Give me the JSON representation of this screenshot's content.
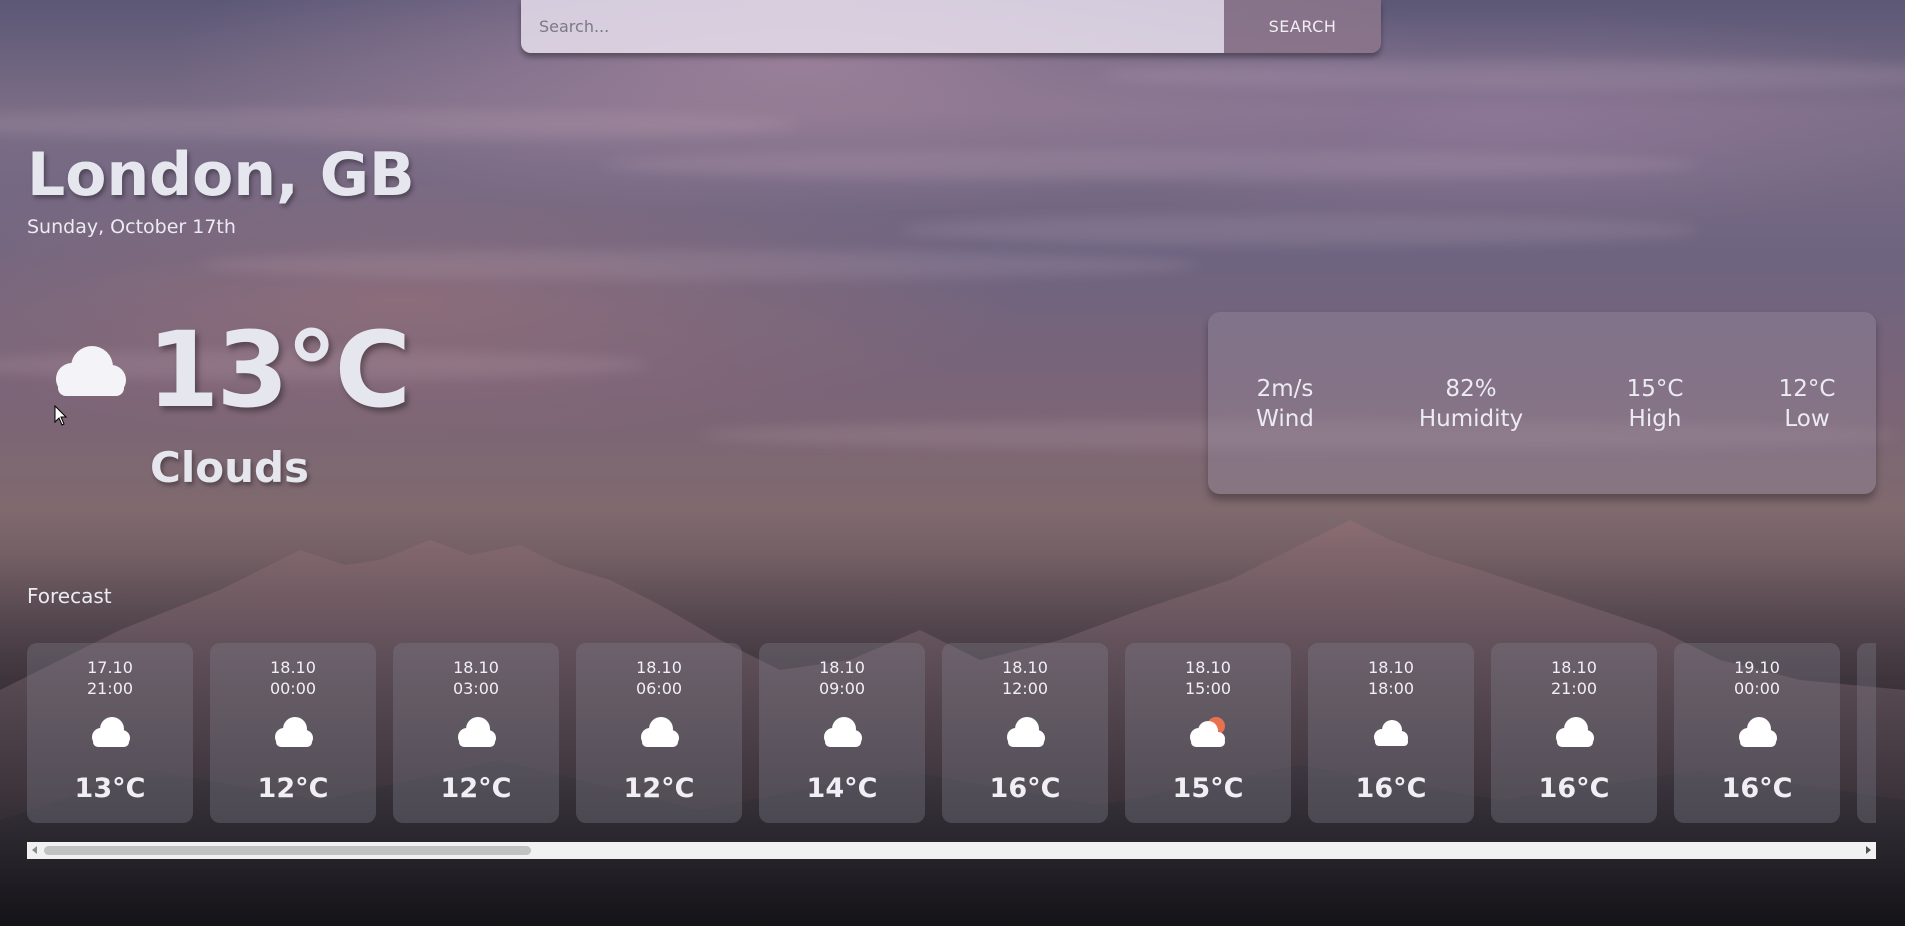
{
  "search": {
    "placeholder": "Search...",
    "button_label": "SEARCH"
  },
  "location": {
    "city": "London, GB",
    "date": "Sunday, October 17th"
  },
  "current": {
    "icon": "cloud-icon",
    "temperature": "13°C",
    "condition": "Clouds"
  },
  "stats": [
    {
      "value": "2m/s",
      "label": "Wind"
    },
    {
      "value": "82%",
      "label": "Humidity"
    },
    {
      "value": "15°C",
      "label": "High"
    },
    {
      "value": "12°C",
      "label": "Low"
    }
  ],
  "forecast": {
    "title": "Forecast",
    "items": [
      {
        "date": "17.10",
        "time": "21:00",
        "icon": "cloud-icon",
        "temp": "13°C"
      },
      {
        "date": "18.10",
        "time": "00:00",
        "icon": "cloud-icon",
        "temp": "12°C"
      },
      {
        "date": "18.10",
        "time": "03:00",
        "icon": "cloud-icon",
        "temp": "12°C"
      },
      {
        "date": "18.10",
        "time": "06:00",
        "icon": "cloud-icon",
        "temp": "12°C"
      },
      {
        "date": "18.10",
        "time": "09:00",
        "icon": "cloud-icon",
        "temp": "14°C"
      },
      {
        "date": "18.10",
        "time": "12:00",
        "icon": "cloud-icon",
        "temp": "16°C"
      },
      {
        "date": "18.10",
        "time": "15:00",
        "icon": "cloud-sun-icon",
        "temp": "15°C"
      },
      {
        "date": "18.10",
        "time": "18:00",
        "icon": "cloud-icon",
        "temp": "16°C"
      },
      {
        "date": "18.10",
        "time": "21:00",
        "icon": "cloud-icon",
        "temp": "16°C"
      },
      {
        "date": "19.10",
        "time": "00:00",
        "icon": "cloud-icon",
        "temp": "16°C"
      }
    ]
  },
  "colors": {
    "text": "#e6e6ef",
    "sun": "#e8714f"
  }
}
